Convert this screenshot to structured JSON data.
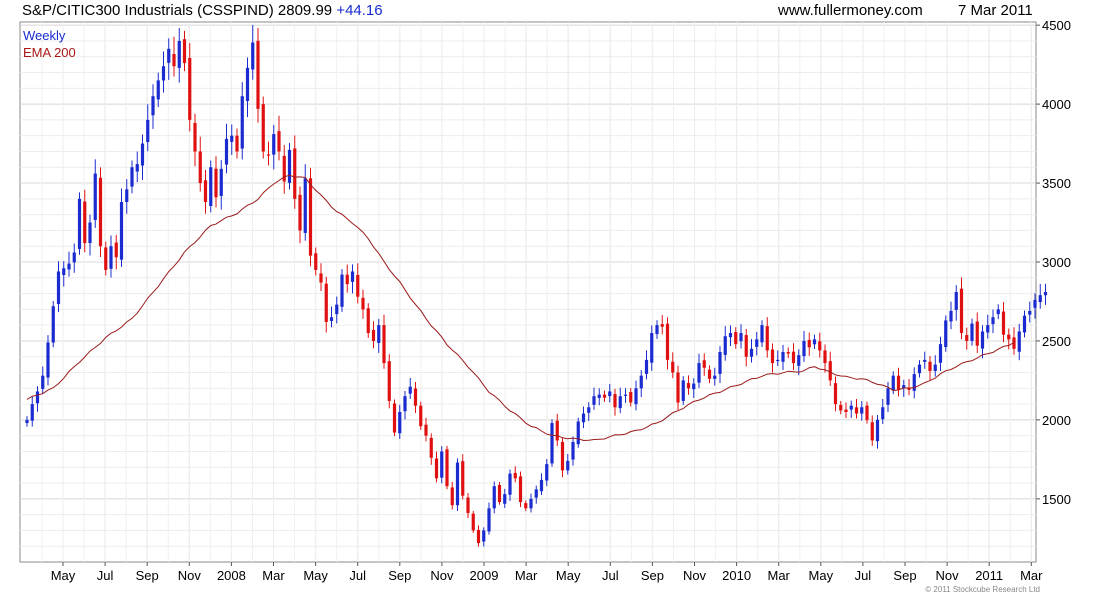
{
  "header": {
    "title": "S&P/CITIC300 Industrials (CSSPIND) 2809.99",
    "change": "+44.16",
    "site": "www.fullermoney.com",
    "date": "7 Mar 2011"
  },
  "footer": {
    "copyright": "© 2011 Stockcube Research Ltd"
  },
  "colors": {
    "up": "#1a2bd0",
    "down": "#e01010",
    "ema": "#9a1a1a",
    "grid": "#d8d8d8"
  },
  "chart_data": {
    "type": "candlestick",
    "frequency": "Weekly",
    "legend": [
      "Weekly",
      "EMA 200"
    ],
    "legend_placement": "top-left",
    "x_tick_labels": [
      "May",
      "Jul",
      "Sep",
      "Nov",
      "2008",
      "Mar",
      "May",
      "Jul",
      "Sep",
      "Nov",
      "2009",
      "Mar",
      "May",
      "Jul",
      "Sep",
      "Nov",
      "2010",
      "Mar",
      "May",
      "Jul",
      "Sep",
      "Nov",
      "2011",
      "Mar"
    ],
    "y_ticks": [
      1500,
      2000,
      2500,
      3000,
      3500,
      4000,
      4500
    ],
    "ylim": [
      1100,
      4520
    ],
    "grid": true,
    "y_axis_side": "right",
    "series": [
      {
        "name": "Weekly",
        "kind": "candles",
        "close": [
          2000,
          2100,
          2180,
          2280,
          2490,
          2720,
          2940,
          2960,
          2990,
          3060,
          3400,
          3120,
          3250,
          3560,
          3100,
          2950,
          3100,
          3030,
          3380,
          3460,
          3600,
          3620,
          3750,
          3900,
          4050,
          4150,
          4240,
          4350,
          4240,
          4400,
          4260,
          3900,
          3700,
          3500,
          3380,
          3600,
          3410,
          3590,
          3780,
          3800,
          3700,
          4050,
          4230,
          4390,
          3970,
          3700,
          3680,
          3810,
          3700,
          3510,
          3710,
          3400,
          3200,
          3530,
          3040,
          2950,
          2870,
          2620,
          2650,
          2730,
          2920,
          2860,
          2940,
          2780,
          2700,
          2550,
          2500,
          2600,
          2360,
          2120,
          1920,
          2050,
          2150,
          2210,
          2090,
          1960,
          1900,
          1760,
          1630,
          1800,
          1580,
          1460,
          1730,
          1520,
          1410,
          1300,
          1220,
          1300,
          1440,
          1580,
          1480,
          1530,
          1660,
          1630,
          1480,
          1440,
          1500,
          1560,
          1620,
          1720,
          1980,
          1870,
          1680,
          1740,
          1860,
          1990,
          2040,
          2080,
          2150,
          2160,
          2140,
          2180,
          2080,
          2150,
          2160,
          2110,
          2200,
          2280,
          2380,
          2550,
          2600,
          2590,
          2380,
          2300,
          2110,
          2250,
          2200,
          2230,
          2360,
          2330,
          2260,
          2280,
          2430,
          2530,
          2550,
          2480,
          2550,
          2400,
          2450,
          2510,
          2600,
          2440,
          2360,
          2380,
          2430,
          2420,
          2360,
          2410,
          2500,
          2460,
          2510,
          2440,
          2360,
          2250,
          2100,
          2060,
          2050,
          2090,
          2040,
          2080,
          2000,
          1870,
          2000,
          2080,
          2200,
          2280,
          2190,
          2220,
          2190,
          2290,
          2350,
          2380,
          2310,
          2350,
          2480,
          2630,
          2690,
          2810,
          2550,
          2500,
          2610,
          2470,
          2560,
          2600,
          2650,
          2700,
          2540,
          2510,
          2450,
          2560,
          2660,
          2690,
          2760,
          2790,
          2810
        ]
      }
    ],
    "series_ema": {
      "name": "EMA 200",
      "kind": "line",
      "knots": [
        [
          0,
          2130
        ],
        [
          5,
          2200
        ],
        [
          10,
          2370
        ],
        [
          15,
          2520
        ],
        [
          20,
          2640
        ],
        [
          25,
          2850
        ],
        [
          30,
          3060
        ],
        [
          35,
          3230
        ],
        [
          40,
          3310
        ],
        [
          44,
          3400
        ],
        [
          47,
          3500
        ],
        [
          50,
          3550
        ],
        [
          53,
          3530
        ],
        [
          56,
          3420
        ],
        [
          59,
          3320
        ],
        [
          62,
          3250
        ],
        [
          65,
          3150
        ],
        [
          68,
          3000
        ],
        [
          71,
          2870
        ],
        [
          74,
          2730
        ],
        [
          77,
          2600
        ],
        [
          80,
          2480
        ],
        [
          84,
          2340
        ],
        [
          88,
          2180
        ],
        [
          92,
          2060
        ],
        [
          96,
          1960
        ],
        [
          100,
          1900
        ],
        [
          104,
          1880
        ],
        [
          108,
          1870
        ],
        [
          112,
          1900
        ],
        [
          116,
          1930
        ],
        [
          120,
          1980
        ],
        [
          124,
          2060
        ],
        [
          128,
          2130
        ],
        [
          132,
          2180
        ],
        [
          136,
          2230
        ],
        [
          140,
          2280
        ],
        [
          144,
          2300
        ],
        [
          148,
          2310
        ],
        [
          150,
          2340
        ],
        [
          153,
          2300
        ],
        [
          156,
          2270
        ],
        [
          159,
          2260
        ],
        [
          162,
          2230
        ],
        [
          165,
          2190
        ],
        [
          168,
          2200
        ],
        [
          171,
          2230
        ],
        [
          174,
          2290
        ],
        [
          177,
          2340
        ],
        [
          180,
          2380
        ],
        [
          183,
          2420
        ],
        [
          186,
          2460
        ],
        [
          188,
          2490
        ]
      ]
    }
  }
}
